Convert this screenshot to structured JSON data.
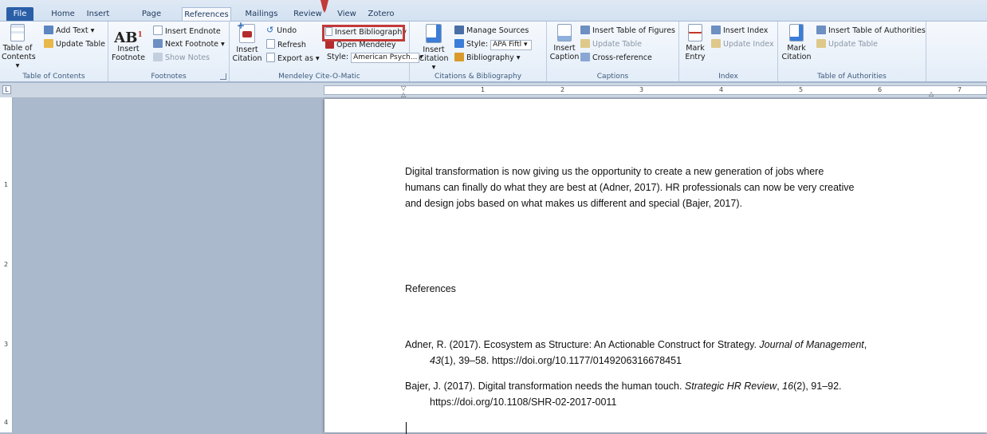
{
  "tabs": [
    "File",
    "Home",
    "Insert",
    "Page Layout",
    "References",
    "Mailings",
    "Review",
    "View",
    "Zotero"
  ],
  "active_tab": "References",
  "ribbon": {
    "toc": {
      "big_label_1": "Table of",
      "big_label_2": "Contents ▾",
      "add_text": "Add Text ▾",
      "update_table": "Update Table",
      "group": "Table of Contents"
    },
    "footnotes": {
      "big_label_1": "Insert",
      "big_label_2": "Footnote",
      "insert_endnote": "Insert Endnote",
      "next_footnote": "Next Footnote ▾",
      "show_notes": "Show Notes",
      "group": "Footnotes",
      "ab": "AB"
    },
    "mendeley": {
      "big_label_1": "Insert",
      "big_label_2": "Citation",
      "undo": "Undo",
      "refresh": "Refresh",
      "export_as": "Export as ▾",
      "style_label": "Style:",
      "style_value": "American Psych...",
      "insert_bibliography": "Insert Bibliography",
      "open_mendeley": "Open Mendeley",
      "group": "Mendeley Cite-O-Matic"
    },
    "citations": {
      "big_label_1": "Insert",
      "big_label_2": "Citation ▾",
      "manage_sources": "Manage Sources",
      "style_label": "Style:",
      "style_value": "APA Fiftl",
      "bibliography": "Bibliography ▾",
      "group": "Citations & Bibliography"
    },
    "captions": {
      "big_label_1": "Insert",
      "big_label_2": "Caption",
      "insert_table_of_figures": "Insert Table of Figures",
      "update_table": "Update Table",
      "cross_reference": "Cross-reference",
      "group": "Captions"
    },
    "index": {
      "big_label_1": "Mark",
      "big_label_2": "Entry",
      "insert_index": "Insert Index",
      "update_index": "Update Index",
      "group": "Index"
    },
    "authorities": {
      "big_label_1": "Mark",
      "big_label_2": "Citation",
      "insert_toa": "Insert Table of Authorities",
      "update_table": "Update Table",
      "group": "Table of Authorities"
    }
  },
  "ruler": {
    "h_numbers": [
      "1",
      "2",
      "3",
      "4",
      "5",
      "6",
      "7"
    ],
    "v_numbers": [
      "1",
      "2",
      "3",
      "4"
    ]
  },
  "document": {
    "paragraph_lines": [
      "Digital transformation is now giving us the opportunity to create a new generation of jobs where",
      "humans can finally do what they are best at (Adner, 2017). HR professionals can now be very creative",
      "and design jobs based on what makes us different and special (Bajer, 2017)."
    ],
    "references_heading": "References",
    "ref1": {
      "line1_a": "Adner, R. (2017). Ecosystem as Structure: An Actionable Construct for Strategy. ",
      "line1_journal": "Journal of Management",
      "line1_b": ",",
      "line2_vol": "43",
      "line2_rest": "(1), 39–58. https://doi.org/10.1177/0149206316678451"
    },
    "ref2": {
      "line1_a": "Bajer, J. (2017). Digital transformation needs the human touch. ",
      "line1_journal": "Strategic HR Review",
      "line1_b": ", ",
      "line1_vol": "16",
      "line1_c": "(2), 91–92.",
      "line2": "https://doi.org/10.1108/SHR-02-2017-0011"
    }
  },
  "colors": {
    "highlight_box": "#c23a38",
    "file_tab": "#2a5fa7"
  }
}
